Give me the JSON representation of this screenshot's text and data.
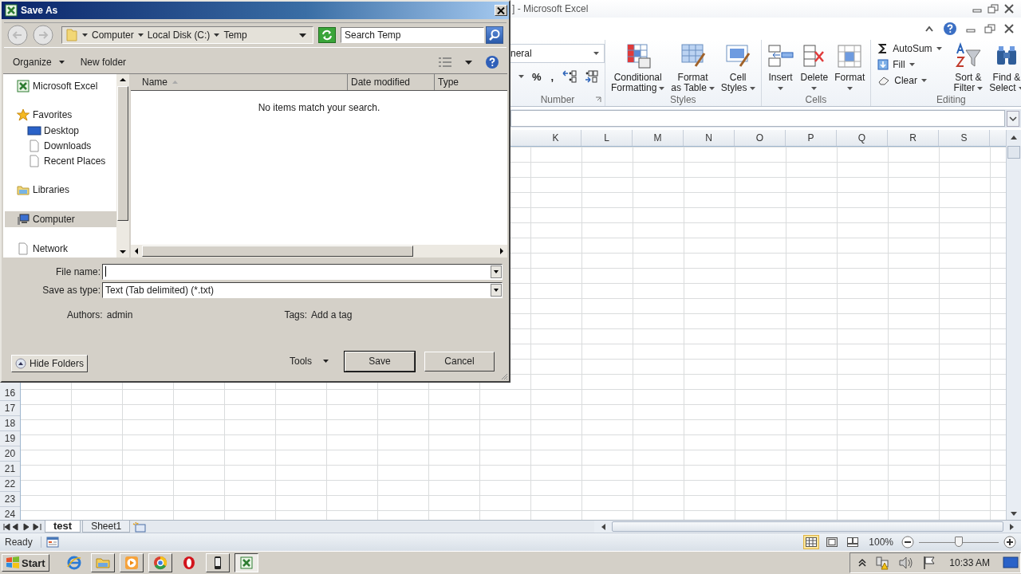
{
  "excel": {
    "title": "] - Microsoft Excel",
    "ribbon_groups": [
      {
        "kind": "number",
        "label": "Number",
        "format": "neral",
        "symbols": [
          "%",
          ","
        ]
      },
      {
        "kind": "large",
        "label": "Styles",
        "buttons": [
          {
            "kind": "conditional",
            "lines": [
              "Conditional",
              "Formatting"
            ],
            "dropdown": true
          },
          {
            "kind": "table",
            "lines": [
              "Format",
              "as Table"
            ],
            "dropdown": true
          },
          {
            "kind": "cellstyles",
            "lines": [
              "Cell",
              "Styles"
            ],
            "dropdown": true
          }
        ]
      },
      {
        "kind": "stacked",
        "label": "Cells",
        "buttons": [
          {
            "kind": "insert",
            "lines": [
              "Insert"
            ],
            "dropdown": true
          },
          {
            "kind": "delete",
            "lines": [
              "Delete"
            ],
            "dropdown": true
          },
          {
            "kind": "format",
            "lines": [
              "Format"
            ],
            "dropdown": true
          }
        ]
      },
      {
        "kind": "editing",
        "label": "Editing",
        "small": [
          {
            "kind": "autosum",
            "label": "AutoSum"
          },
          {
            "kind": "fill",
            "label": "Fill"
          },
          {
            "kind": "clear",
            "label": "Clear"
          }
        ],
        "buttons": [
          {
            "kind": "sort",
            "lines": [
              "Sort &",
              "Filter"
            ],
            "dropdown": true
          },
          {
            "kind": "find",
            "lines": [
              "Find &",
              "Select"
            ],
            "dropdown": true
          }
        ]
      }
    ],
    "columns": [
      "K",
      "L",
      "M",
      "N",
      "O",
      "P",
      "Q",
      "R",
      "S"
    ],
    "rows": [
      "16",
      "17",
      "18",
      "19",
      "20",
      "21",
      "22",
      "23",
      "24"
    ],
    "sheet_tabs": [
      {
        "label": "test",
        "selected": true
      },
      {
        "label": "Sheet1",
        "selected": false
      }
    ],
    "status": "Ready",
    "views": [
      {
        "kind": "normal",
        "selected": true
      },
      {
        "kind": "layout",
        "selected": false
      },
      {
        "kind": "pagebreak",
        "selected": false
      }
    ],
    "zoom": "100%",
    "zoom_slider": {
      "level": 0.5
    }
  },
  "dialog": {
    "title": "Save As",
    "breadcrumb": [
      "Computer",
      "Local Disk (C:)",
      "Temp"
    ],
    "search": {
      "placeholder": "Search Temp"
    },
    "toolbar": {
      "organize": "Organize",
      "new_folder": "New folder"
    },
    "nav": [
      {
        "label": "Microsoft Excel",
        "kind": "excel",
        "selected": false
      },
      {
        "label": "Favorites",
        "kind": "star",
        "selected": false,
        "children": [
          {
            "label": "Desktop",
            "kind": "desktop",
            "selected": false
          },
          {
            "label": "Downloads",
            "kind": "page",
            "selected": false
          },
          {
            "label": "Recent Places",
            "kind": "page",
            "selected": false
          }
        ]
      },
      {
        "label": "Libraries",
        "kind": "libraries",
        "selected": false
      },
      {
        "label": "Computer",
        "kind": "computer",
        "selected": true
      },
      {
        "label": "Network",
        "kind": "page",
        "selected": false
      }
    ],
    "columns": [
      "Name",
      "Date modified",
      "Type"
    ],
    "empty_message": "No items match your search.",
    "file_name_label": "File name:",
    "save_type_label": "Save as type:",
    "save_type": "Text (Tab delimited) (*.txt)",
    "authors_label": "Authors:",
    "authors": "admin",
    "tags_label": "Tags:",
    "tags": "Add a tag",
    "hide_folders": "Hide Folders",
    "tools": "Tools",
    "save": "Save",
    "cancel": "Cancel"
  },
  "taskbar": {
    "start": "Start",
    "clock": "10:33 AM",
    "apps": [
      {
        "kind": "ie",
        "running": false,
        "selected": false
      },
      {
        "kind": "folder",
        "running": true,
        "selected": false
      },
      {
        "kind": "media",
        "running": true,
        "selected": false
      },
      {
        "kind": "chrome",
        "running": true,
        "selected": false
      },
      {
        "kind": "opera",
        "running": false,
        "selected": false
      },
      {
        "kind": "phone",
        "running": true,
        "selected": false
      },
      {
        "kind": "excel",
        "running": true,
        "selected": true
      }
    ]
  }
}
